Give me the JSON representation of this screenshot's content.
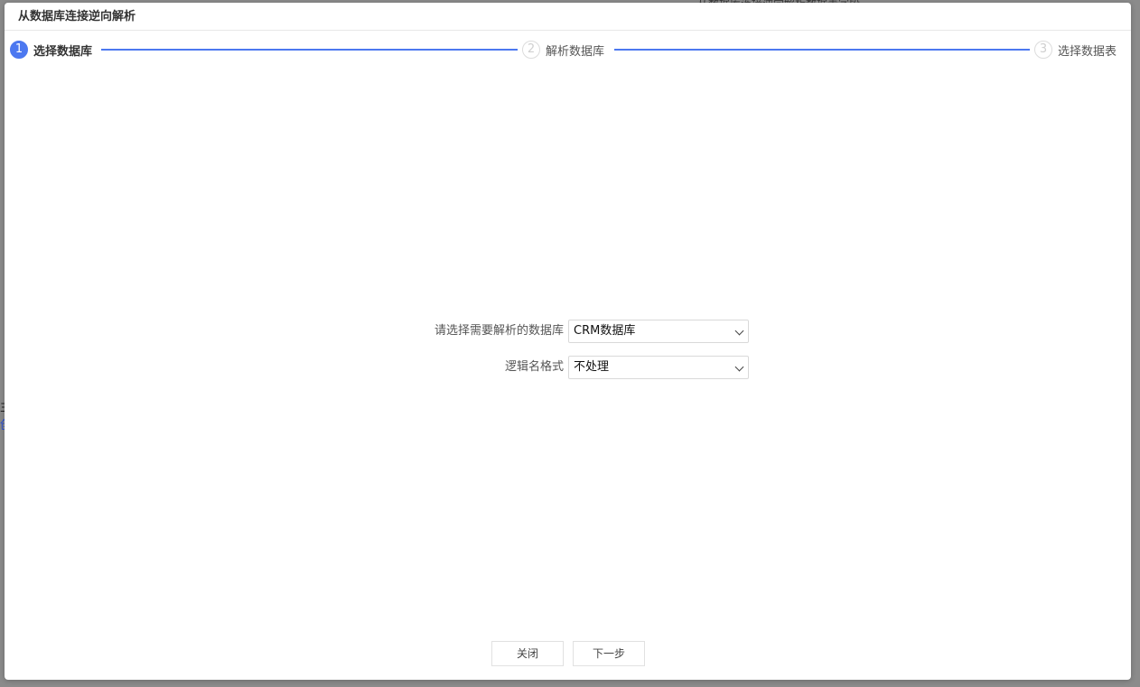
{
  "background": {
    "top_fragment": "从数据库连接逆向解析数据表字段",
    "left_fragment_line1": "主",
    "left_fragment_line2": "创"
  },
  "dialog": {
    "title": "从数据库连接逆向解析"
  },
  "steps": [
    {
      "number": "1",
      "label": "选择数据库",
      "state": "active"
    },
    {
      "number": "2",
      "label": "解析数据库",
      "state": "inactive"
    },
    {
      "number": "3",
      "label": "选择数据表",
      "state": "inactive"
    }
  ],
  "form": {
    "database_label": "请选择需要解析的数据库",
    "database_value": "CRM数据库",
    "logical_name_label": "逻辑名格式",
    "logical_name_value": "不处理"
  },
  "footer": {
    "close_label": "关闭",
    "next_label": "下一步"
  },
  "colors": {
    "accent": "#4c78f0",
    "overlay": "#8b8b8b"
  }
}
